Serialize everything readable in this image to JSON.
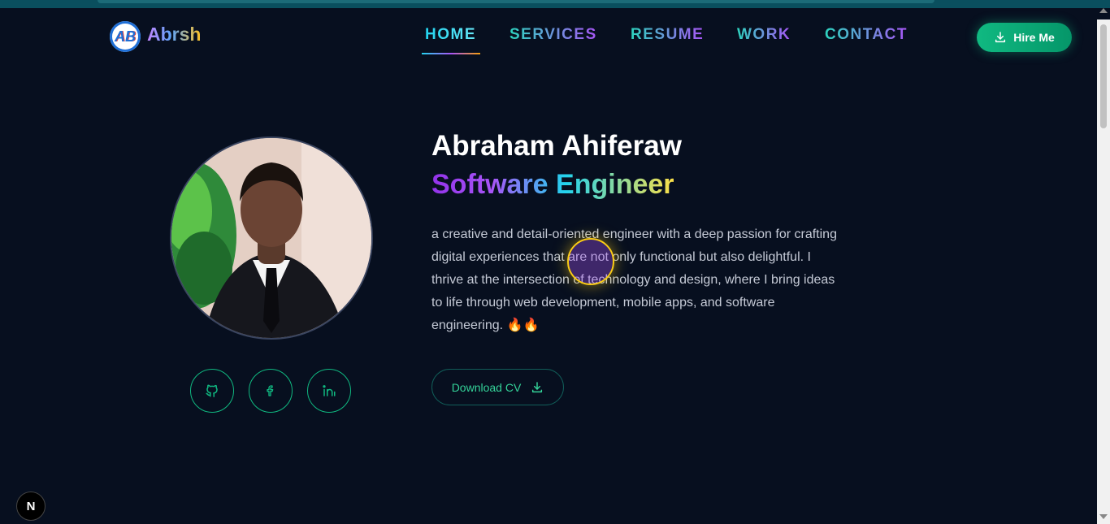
{
  "brand": {
    "badge": "AB",
    "name": "Abrsh"
  },
  "nav": {
    "items": [
      {
        "label": "HOME",
        "active": true
      },
      {
        "label": "SERVICES",
        "active": false
      },
      {
        "label": "RESUME",
        "active": false
      },
      {
        "label": "WORK",
        "active": false
      },
      {
        "label": "CONTACT",
        "active": false
      }
    ]
  },
  "header": {
    "hire_label": "Hire Me",
    "hire_icon": "download-icon"
  },
  "profile": {
    "photo": "profile-photo",
    "social": [
      {
        "name": "github-icon"
      },
      {
        "name": "facebook-icon"
      },
      {
        "name": "linkedin-icon"
      }
    ]
  },
  "hero": {
    "name": "Abraham Ahiferaw",
    "role": "Software Engineer",
    "bio": "a creative and detail-oriented engineer with a deep passion for crafting digital experiences that are not only functional but also delightful. I thrive at the intersection of technology and design, where I bring ideas to life through web development, mobile apps, and software engineering. 🔥🔥",
    "cv_label": "Download CV",
    "cv_icon": "download-icon"
  },
  "devtools": {
    "badge": "N"
  },
  "colors": {
    "background": "#070f1f",
    "accent": "#10b981",
    "nav_gradient": [
      "#2dd4bf",
      "#a855f7"
    ],
    "role_gradient": [
      "#9333ea",
      "#22d3ee",
      "#fde047"
    ]
  }
}
